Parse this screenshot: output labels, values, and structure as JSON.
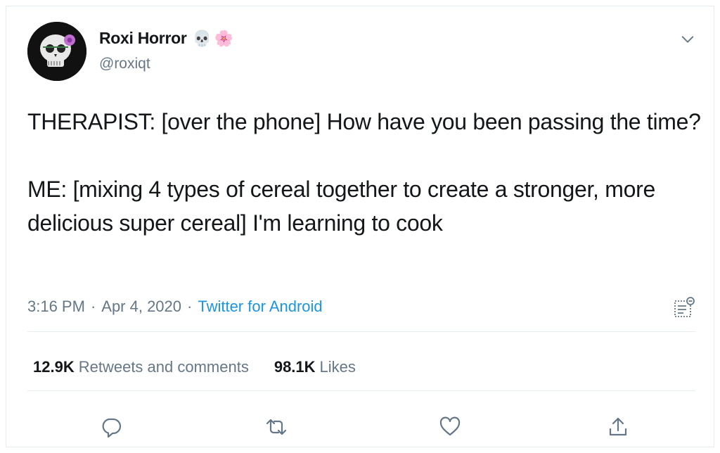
{
  "user": {
    "name": "Roxi Horror",
    "name_emojis": [
      "💀",
      "🌸"
    ],
    "handle": "@roxiqt"
  },
  "tweet": {
    "text": "THERAPIST: [over the phone] How have you been passing the time?\n\nME: [mixing 4 types of cereal together to create a stronger, more delicious super cereal] I'm learning to cook",
    "time": "3:16 PM",
    "separator": "·",
    "date": "Apr 4, 2020",
    "source": "Twitter for Android"
  },
  "stats": {
    "retweets_count": "12.9K",
    "retweets_label": "Retweets and comments",
    "likes_count": "98.1K",
    "likes_label": "Likes"
  },
  "icons": {
    "more": "chevron-down-icon",
    "analytics": "analytics-icon",
    "reply": "reply-icon",
    "retweet": "retweet-icon",
    "like": "heart-icon",
    "share": "share-icon"
  },
  "colors": {
    "text": "#14171a",
    "muted": "#657786",
    "link": "#1b95e0",
    "divider": "#e6ecf0"
  }
}
